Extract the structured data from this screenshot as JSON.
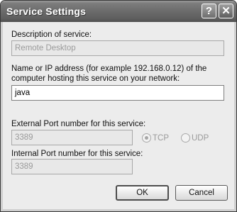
{
  "window": {
    "title": "Service Settings",
    "help_glyph": "?",
    "close_glyph": "✕"
  },
  "description": {
    "label": "Description of service:",
    "value": "Remote Desktop"
  },
  "host": {
    "label_line1": "Name or IP address (for example 192.168.0.12) of the",
    "label_line2": "computer hosting this service on your network:",
    "value": "java"
  },
  "external_port": {
    "label": "External Port number for this service:",
    "value": "3389"
  },
  "internal_port": {
    "label": "Internal Port number for this service:",
    "value": "3389"
  },
  "protocol": {
    "selected": "TCP",
    "tcp_label": "TCP",
    "udp_label": "UDP"
  },
  "buttons": {
    "ok_label": "OK",
    "cancel_label": "Cancel"
  },
  "icons": [
    "help-icon",
    "close-icon"
  ]
}
